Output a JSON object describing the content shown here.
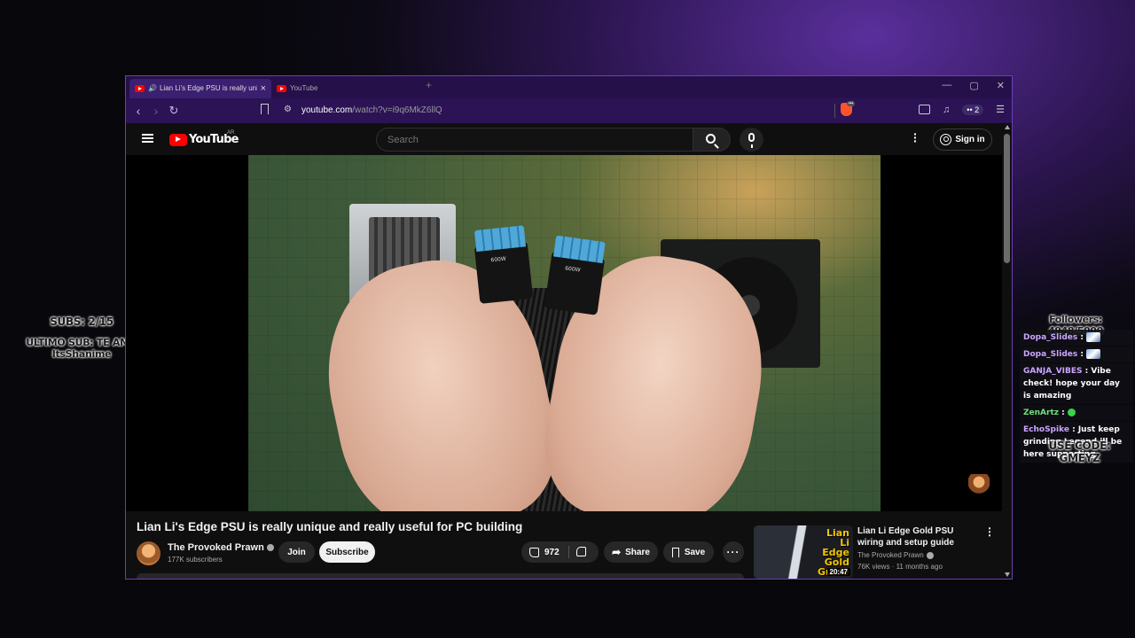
{
  "overlay": {
    "subs": "SUBS: 2/15",
    "last_sub": "ULTIMO SUB: TE AMO ItsShanime",
    "followers": "Followers: 4948/5000",
    "use_code": "USE CODE: GMEYZ",
    "chat": [
      {
        "user": "Dopa_Slides",
        "message": ""
      },
      {
        "user": "Dopa_Slides",
        "message": ""
      },
      {
        "user": "GANJA_VIBES",
        "message": "Vibe check! hope your day is amazing"
      },
      {
        "user": "ZenArtz",
        "message": ""
      },
      {
        "user": "EchoSpike",
        "message": "Just keep grinding Legend ill be here supporting"
      }
    ]
  },
  "browser": {
    "tabs": [
      {
        "title": "Lian Li's Edge PSU is really unique and really useful for PC building",
        "active": true
      },
      {
        "title": "YouTube",
        "active": false
      }
    ],
    "url_host": "youtube.com",
    "url_path": "/watch?v=i9q6MkZ6llQ",
    "extension_count": "2",
    "accent_color": "#6b3fb8"
  },
  "youtube": {
    "logo_text": "YouTube",
    "country_code": "AR",
    "search_placeholder": "Search",
    "sign_in": "Sign in",
    "video": {
      "title": "Lian Li's Edge PSU is really unique and really useful for PC building",
      "channel": "The Provoked Prawn",
      "subscribers": "177K subscribers",
      "join": "Join",
      "subscribe": "Subscribe",
      "likes": "972",
      "share": "Share",
      "save": "Save",
      "plug_label": "600W"
    },
    "recommendation": {
      "title": "Lian Li Edge Gold PSU wiring and setup guide",
      "channel": "The Provoked Prawn",
      "meta": "76K views · 11 months ago",
      "duration": "20:47",
      "thumb_text": "Lian Li Edge Gold Guide"
    }
  }
}
